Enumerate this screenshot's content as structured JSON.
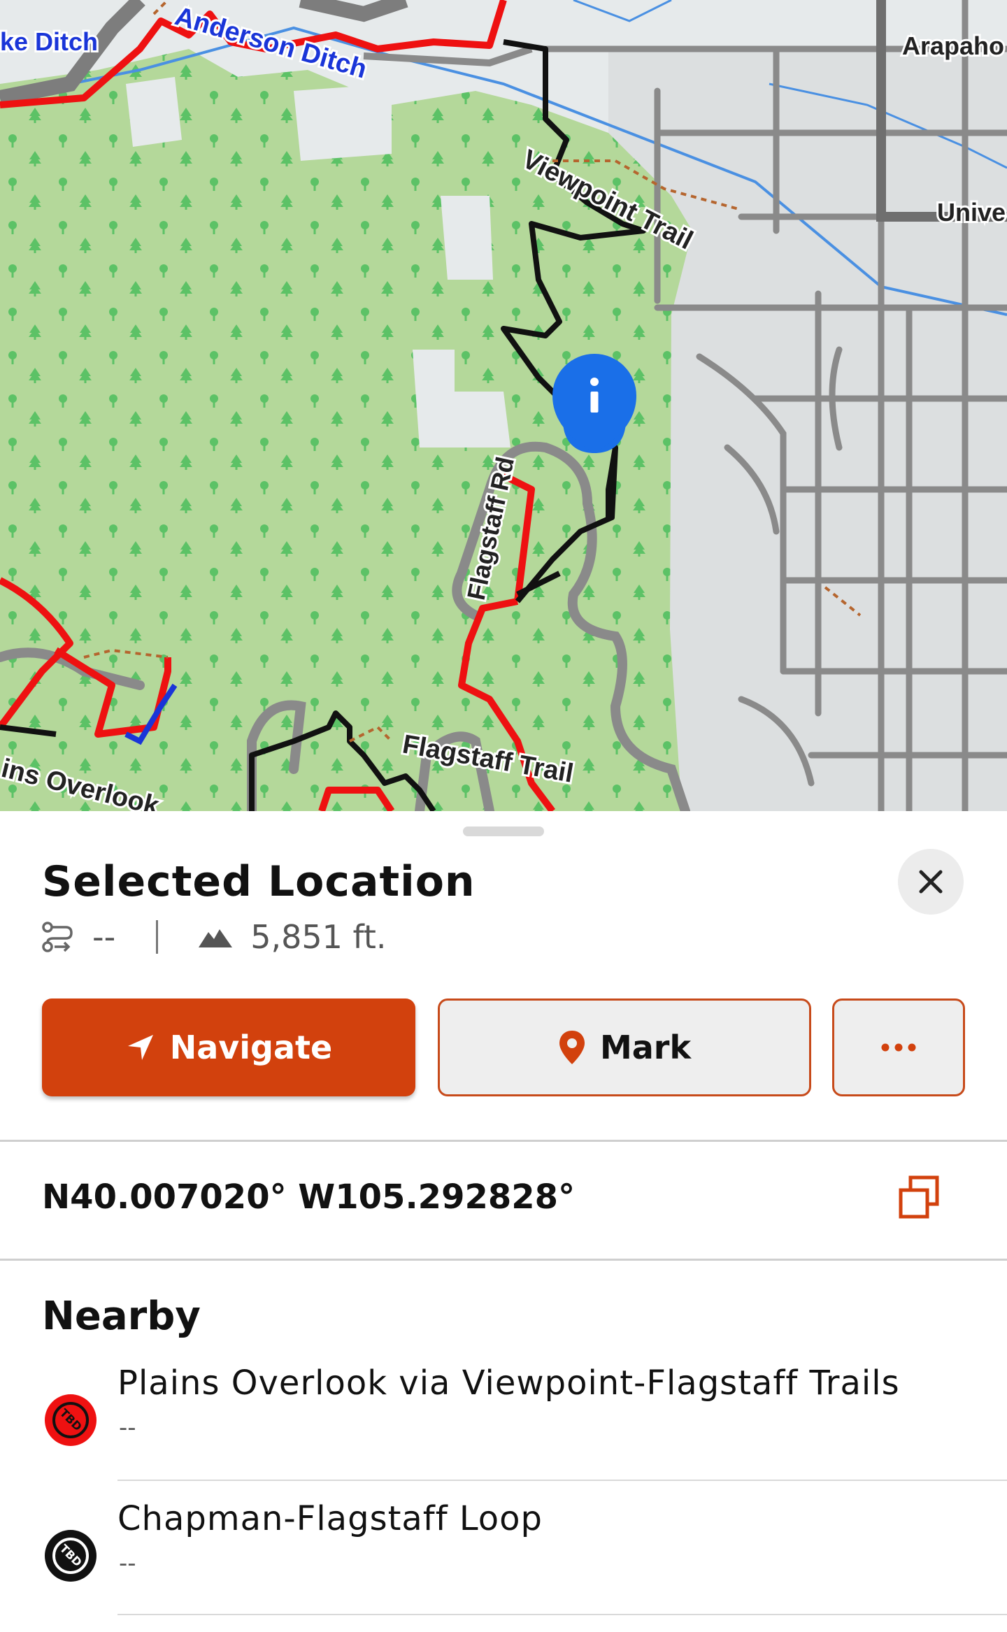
{
  "map": {
    "labels": {
      "ditch_left": "ke Ditch",
      "ditch_right": "Anderson Ditch",
      "arapahoe": "Arapaho",
      "university": "Unive",
      "viewpoint_trail": "Viewpoint Trail",
      "flagstaff_rd": "Flagstaff Rd",
      "flagstaff_trail": "Flagstaff Trail",
      "plains_overlook": "ins Overlook"
    },
    "pin_icon": "info-pin-icon",
    "colors": {
      "forest": "#b4d89a",
      "urban": "#e6eaeb",
      "trail_red": "#ee1111",
      "trail_black": "#111111",
      "road": "#8a8a8a",
      "water": "#4a90e2",
      "pin": "#1a6fe8"
    }
  },
  "sheet": {
    "title": "Selected Location",
    "distance": "--",
    "elevation": "5,851 ft.",
    "buttons": {
      "navigate": "Navigate",
      "mark": "Mark",
      "more": "..."
    },
    "coordinates": "N40.007020° W105.292828°",
    "nearby_heading": "Nearby",
    "nearby": [
      {
        "name": "Plains Overlook via Viewpoint-Flagstaff Trails",
        "sub": "--",
        "badge": "TBD",
        "color": "#ee1111"
      },
      {
        "name": "Chapman-Flagstaff Loop",
        "sub": "--",
        "badge": "TBD",
        "color": "#111111"
      }
    ],
    "accent": "#d2410d"
  }
}
